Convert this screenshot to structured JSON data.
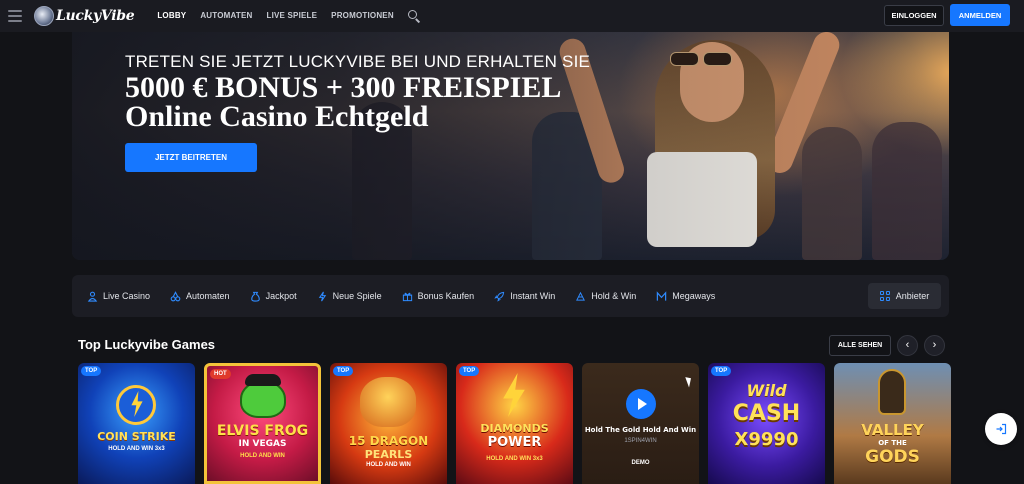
{
  "header": {
    "logo_text": "LuckyVibe",
    "nav": [
      {
        "label": "LOBBY"
      },
      {
        "label": "AUTOMATEN"
      },
      {
        "label": "LIVE SPIELE"
      },
      {
        "label": "PROMOTIONEN"
      }
    ],
    "login_label": "EINLOGGEN",
    "register_label": "ANMELDEN"
  },
  "hero": {
    "subtitle": "TRETEN SIE JETZT LUCKYVIBE BEI UND ERHALTEN SIE",
    "title_line1": "5000 € BONUS + 300 FREISPIEL",
    "title_line2": "Online Casino Echtgeld",
    "cta_label": "JETZT BEITRETEN"
  },
  "categories": {
    "items": [
      {
        "label": "Live Casino",
        "icon": "live-casino-icon"
      },
      {
        "label": "Automaten",
        "icon": "cherries-icon"
      },
      {
        "label": "Jackpot",
        "icon": "jackpot-bag-icon"
      },
      {
        "label": "Neue Spiele",
        "icon": "lightning-icon"
      },
      {
        "label": "Bonus Kaufen",
        "icon": "gift-icon"
      },
      {
        "label": "Instant Win",
        "icon": "rocket-icon"
      },
      {
        "label": "Hold & Win",
        "icon": "hold-win-icon"
      },
      {
        "label": "Megaways",
        "icon": "megaways-icon"
      }
    ],
    "providers_label": "Anbieter"
  },
  "games_section": {
    "title": "Top Luckyvibe Games",
    "see_all_label": "ALLE SEHEN",
    "prev_icon": "chevron-left-icon",
    "next_icon": "chevron-right-icon"
  },
  "games": [
    {
      "badge": "TOP",
      "name": "COIN STRIKE",
      "sub": "HOLD AND WIN 3x3"
    },
    {
      "badge": "HOT",
      "name": "ELVIS FROG",
      "line2": "IN VEGAS",
      "sub": "HOLD AND WIN"
    },
    {
      "badge": "TOP",
      "name": "15 DRAGON",
      "line2": "PEARLS",
      "sub": "HOLD AND WIN"
    },
    {
      "badge": "TOP",
      "name": "DIAMONDS",
      "line2": "POWER",
      "sub": "HOLD AND WIN 3x3"
    },
    {
      "title": "Hold The Gold Hold And Win",
      "provider": "1SPIN4WIN",
      "demo": "DEMO"
    },
    {
      "badge": "TOP",
      "name": "Wild",
      "line2": "CASH",
      "line3": "X9990"
    },
    {
      "name": "VALLEY",
      "line2": "OF THE",
      "line3": "GODS"
    }
  ],
  "colors": {
    "accent": "#1677ff",
    "background": "#121317",
    "panel": "#1c1d24"
  }
}
